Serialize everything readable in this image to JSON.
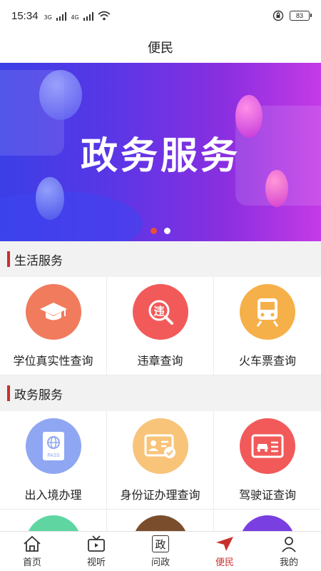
{
  "status": {
    "time": "15:34",
    "sim1": "3G",
    "sim2": "4G",
    "battery": "83"
  },
  "header": {
    "title": "便民"
  },
  "banner": {
    "headline": "政务服务",
    "slide_count": 2,
    "active_slide": 1
  },
  "sections": [
    {
      "title": "生活服务",
      "items": [
        {
          "label": "学位真实性查询",
          "icon": "graduation-cap-icon",
          "color": "#f07b5d"
        },
        {
          "label": "违章查询",
          "icon": "traffic-violation-icon",
          "color": "#f25a5a"
        },
        {
          "label": "火车票查询",
          "icon": "train-icon",
          "color": "#f6b04a"
        }
      ]
    },
    {
      "title": "政务服务",
      "items": [
        {
          "label": "出入境办理",
          "icon": "passport-icon",
          "color": "#8fa7f2"
        },
        {
          "label": "身份证办理查询",
          "icon": "id-card-icon",
          "color": "#f8c47a"
        },
        {
          "label": "驾驶证查询",
          "icon": "driver-license-icon",
          "color": "#f25a5a"
        }
      ]
    }
  ],
  "partial_row_colors": [
    "#5fd6a2",
    "#7a4e2d",
    "#7a3fe0"
  ],
  "tabs": [
    {
      "label": "首页",
      "icon": "home-icon"
    },
    {
      "label": "视听",
      "icon": "tv-icon"
    },
    {
      "label": "问政",
      "icon_text": "政"
    },
    {
      "label": "便民",
      "icon": "send-icon",
      "active": true
    },
    {
      "label": "我的",
      "icon": "user-icon"
    }
  ],
  "colors": {
    "accent": "#c9302c",
    "active_dot": "#e8503a"
  }
}
